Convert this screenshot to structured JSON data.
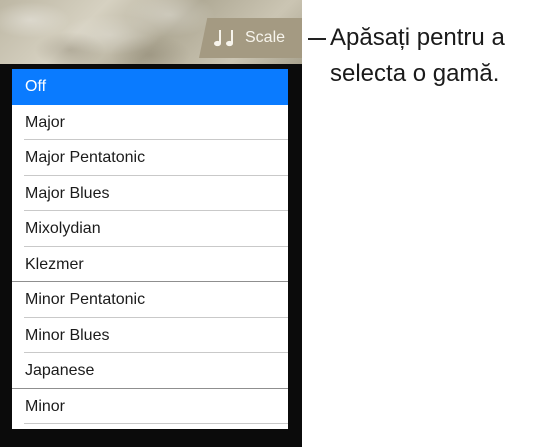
{
  "toolbar": {
    "scale_button": {
      "icon": "music-notes-icon",
      "label": "Scale"
    }
  },
  "scale_menu": {
    "selected_index": 0,
    "items": [
      {
        "label": "Off"
      },
      {
        "label": "Major"
      },
      {
        "label": "Major Pentatonic"
      },
      {
        "label": "Major Blues"
      },
      {
        "label": "Mixolydian"
      },
      {
        "label": "Klezmer"
      },
      {
        "label": "Minor Pentatonic"
      },
      {
        "label": "Minor Blues"
      },
      {
        "label": "Japanese"
      },
      {
        "label": "Minor"
      }
    ]
  },
  "callout": {
    "line1": "Apăsați pentru a",
    "line2": "selecta o gamă."
  },
  "colors": {
    "selection": "#0a7bff",
    "frame": "#0b0b0b",
    "scale_button": "#a49a82"
  }
}
